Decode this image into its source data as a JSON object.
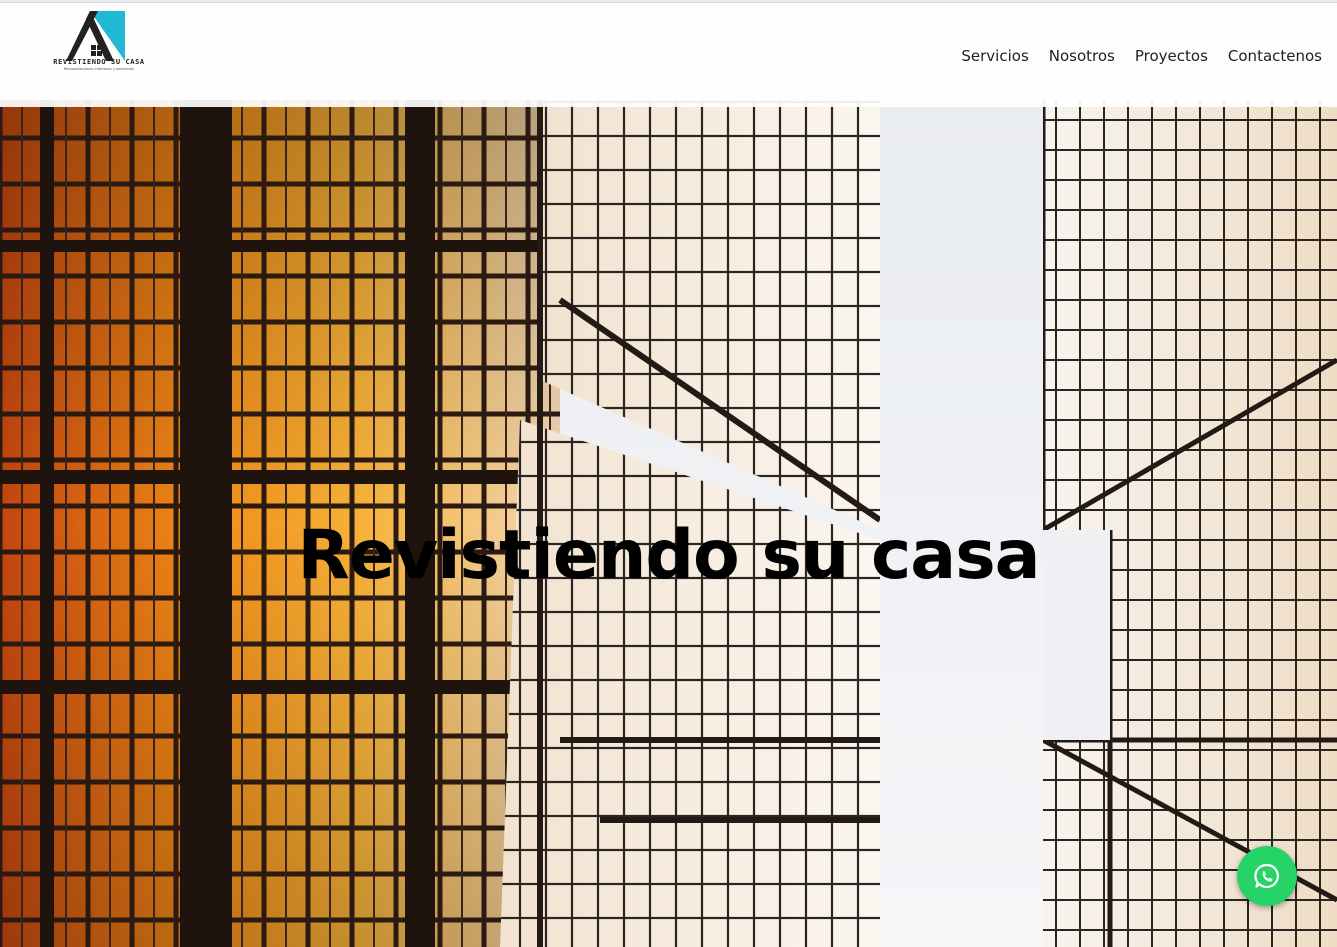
{
  "brand": {
    "name": "REVISTIENDO SU CASA",
    "tagline": "Remodelaciones interiores y exteriores",
    "colors": {
      "accent": "#1fb9d4",
      "whatsapp": "#25d366"
    }
  },
  "nav": {
    "items": [
      {
        "label": "Servicios"
      },
      {
        "label": "Nosotros"
      },
      {
        "label": "Proyectos"
      },
      {
        "label": "Contactenos"
      }
    ]
  },
  "hero": {
    "title": "Revistiendo su casa",
    "background_icon": "glass-skyscrapers-photo"
  },
  "floating": {
    "whatsapp_icon": "whatsapp-icon"
  }
}
